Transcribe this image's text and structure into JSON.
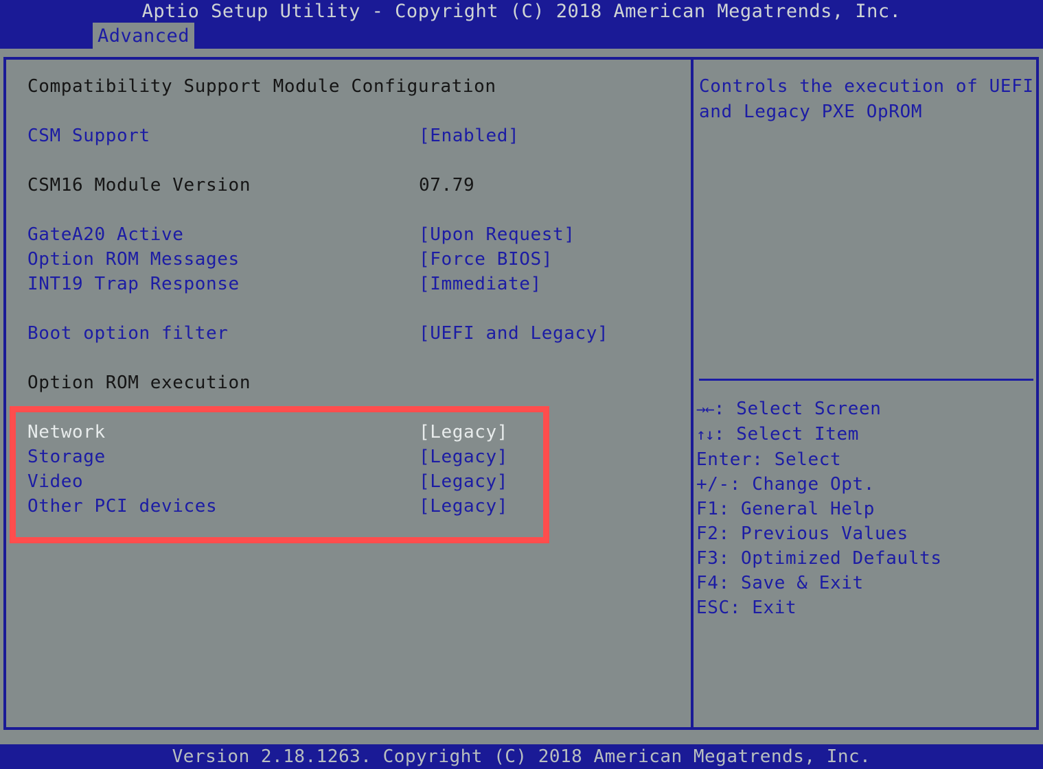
{
  "titlebar": {
    "text": "Aptio Setup Utility - Copyright (C) 2018 American Megatrends, Inc."
  },
  "tabs": [
    {
      "label": "Advanced",
      "active": true
    }
  ],
  "main": {
    "section_title": "Compatibility Support Module Configuration",
    "rows": [
      {
        "label": "CSM Support",
        "value": "[Enabled]",
        "style": "blue",
        "interactable": true
      },
      {
        "label": "CSM16 Module Version",
        "value": "07.79",
        "style": "dark",
        "interactable": false
      },
      {
        "label": "GateA20 Active",
        "value": "[Upon Request]",
        "style": "blue",
        "interactable": true
      },
      {
        "label": "Option ROM Messages",
        "value": "[Force BIOS]",
        "style": "blue",
        "interactable": true
      },
      {
        "label": "INT19 Trap Response",
        "value": "[Immediate]",
        "style": "blue",
        "interactable": true
      },
      {
        "label": "Boot option filter",
        "value": "[UEFI and Legacy]",
        "style": "blue",
        "interactable": true
      }
    ],
    "subsection_title": "Option ROM execution",
    "oprom_rows": [
      {
        "label": "Network",
        "value": "[Legacy]",
        "style": "white",
        "interactable": true
      },
      {
        "label": "Storage",
        "value": "[Legacy]",
        "style": "blue",
        "interactable": true
      },
      {
        "label": "Video",
        "value": "[Legacy]",
        "style": "blue",
        "interactable": true
      },
      {
        "label": "Other PCI devices",
        "value": "[Legacy]",
        "style": "blue",
        "interactable": true
      }
    ]
  },
  "help": {
    "lines": [
      "Controls the execution of UEFI",
      "and Legacy PXE OpROM"
    ]
  },
  "keys": [
    {
      "glyph": "→←",
      "text": ": Select Screen"
    },
    {
      "glyph": "↑↓",
      "text": ": Select Item"
    },
    {
      "glyph": "",
      "text": "Enter: Select"
    },
    {
      "glyph": "",
      "text": "+/-: Change Opt."
    },
    {
      "glyph": "",
      "text": "F1: General Help"
    },
    {
      "glyph": "",
      "text": "F2: Previous Values"
    },
    {
      "glyph": "",
      "text": "F3: Optimized Defaults"
    },
    {
      "glyph": "",
      "text": "F4: Save & Exit"
    },
    {
      "glyph": "",
      "text": "ESC: Exit"
    }
  ],
  "footer": {
    "text": "Version 2.18.1263. Copyright (C) 2018 American Megatrends, Inc."
  },
  "annotation": {
    "color": "#ff4d4d",
    "target": "Option ROM execution device list"
  }
}
